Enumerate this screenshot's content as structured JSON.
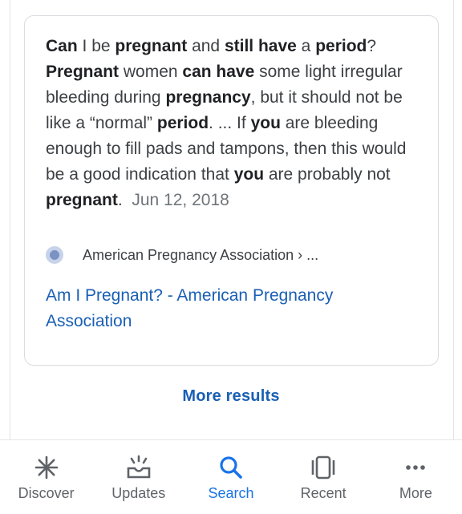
{
  "snippet": {
    "segments": [
      {
        "t": "Can",
        "b": true
      },
      {
        "t": " I be ",
        "b": false
      },
      {
        "t": "pregnant",
        "b": true
      },
      {
        "t": " and ",
        "b": false
      },
      {
        "t": "still have",
        "b": true
      },
      {
        "t": " a ",
        "b": false
      },
      {
        "t": "period",
        "b": true
      },
      {
        "t": "? ",
        "b": false
      },
      {
        "t": "Pregnant",
        "b": true
      },
      {
        "t": " women ",
        "b": false
      },
      {
        "t": "can have",
        "b": true
      },
      {
        "t": " some light irregular bleeding during ",
        "b": false
      },
      {
        "t": "pregnancy",
        "b": true
      },
      {
        "t": ", but it should not be like a “normal” ",
        "b": false
      },
      {
        "t": "period",
        "b": true
      },
      {
        "t": ". ... If ",
        "b": false
      },
      {
        "t": "you",
        "b": true
      },
      {
        "t": " are bleeding enough to fill pads and tampons, then this would be a good indication that ",
        "b": false
      },
      {
        "t": "you",
        "b": true
      },
      {
        "t": " are probably not ",
        "b": false
      },
      {
        "t": "pregnant",
        "b": true
      },
      {
        "t": ".",
        "b": false
      }
    ],
    "date": "Jun 12, 2018"
  },
  "source": {
    "name": "American Pregnancy Association › ...",
    "icon": "globe-icon"
  },
  "result": {
    "title": "Am I Pregnant? - American Pregnancy Association"
  },
  "more_results_label": "More results",
  "nav": [
    {
      "label": "Discover",
      "icon": "discover-icon",
      "active": false
    },
    {
      "label": "Updates",
      "icon": "updates-icon",
      "active": false
    },
    {
      "label": "Search",
      "icon": "search-icon",
      "active": true
    },
    {
      "label": "Recent",
      "icon": "recent-icon",
      "active": false
    },
    {
      "label": "More",
      "icon": "more-icon",
      "active": false
    }
  ],
  "colors": {
    "accent": "#1a73e8",
    "link": "#1a5fb4",
    "text": "#3c4043",
    "muted": "#70757a"
  }
}
